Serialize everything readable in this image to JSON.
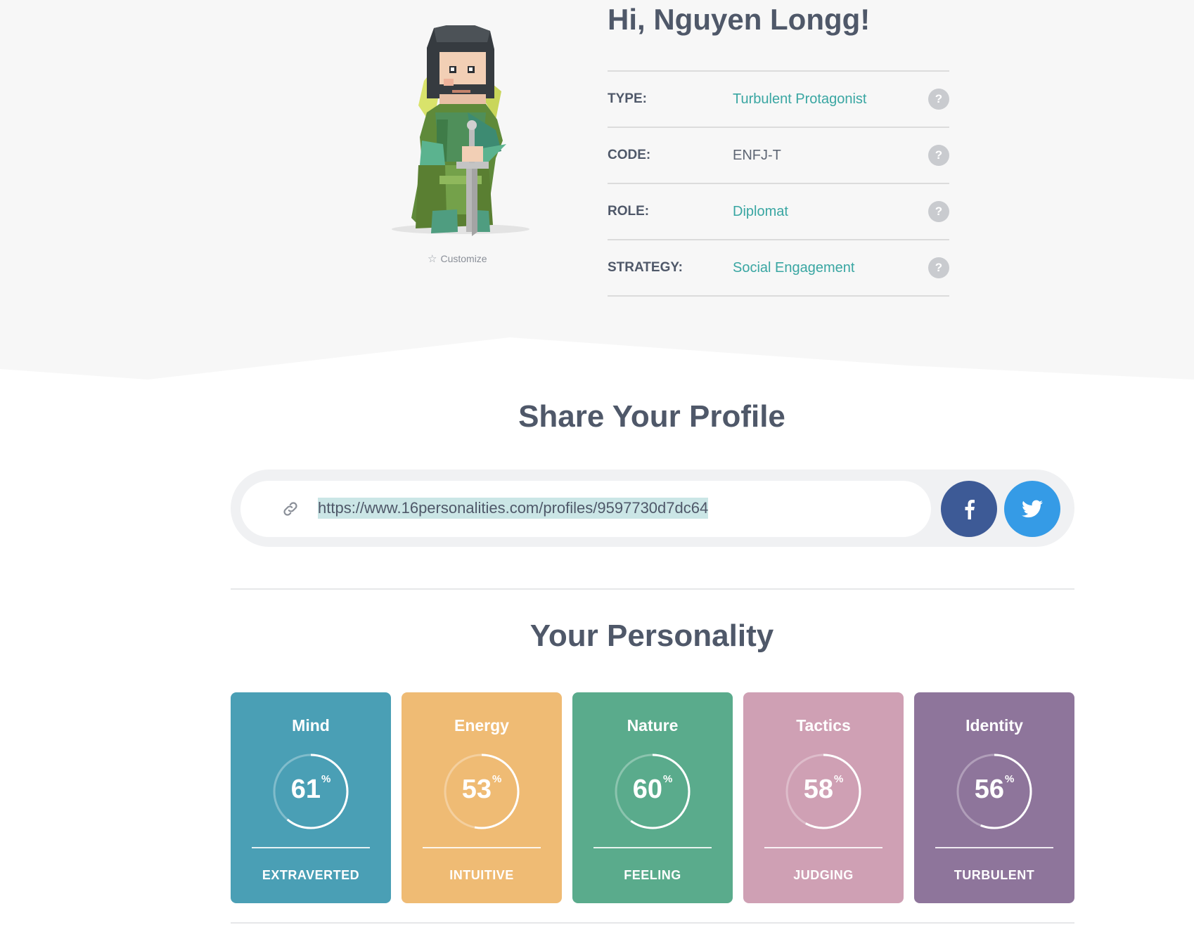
{
  "profile": {
    "greeting": "Hi, Nguyen Longg!",
    "customize_label": "Customize",
    "rows": [
      {
        "label": "TYPE:",
        "value": "Turbulent Protagonist",
        "help": "?"
      },
      {
        "label": "CODE:",
        "value": "ENFJ-T",
        "help": "?"
      },
      {
        "label": "ROLE:",
        "value": "Diplomat",
        "help": "?"
      },
      {
        "label": "STRATEGY:",
        "value": "Social Engagement",
        "help": "?"
      }
    ]
  },
  "share": {
    "title": "Share Your Profile",
    "url": "https://www.16personalities.com/profiles/9597730d7dc64",
    "facebook_icon": "facebook-icon",
    "twitter_icon": "twitter-icon"
  },
  "personality": {
    "title": "Your Personality",
    "percent_symbol": "%",
    "traits": [
      {
        "title": "Mind",
        "percent": 61,
        "trait": "EXTRAVERTED",
        "color": "#4a9fb5"
      },
      {
        "title": "Energy",
        "percent": 53,
        "trait": "INTUITIVE",
        "color": "#efbb74"
      },
      {
        "title": "Nature",
        "percent": 60,
        "trait": "FEELING",
        "color": "#5aab8c"
      },
      {
        "title": "Tactics",
        "percent": 58,
        "trait": "JUDGING",
        "color": "#cfa0b4"
      },
      {
        "title": "Identity",
        "percent": 56,
        "trait": "TURBULENT",
        "color": "#8e759b"
      }
    ]
  },
  "colors": {
    "hero_background": "#f7f7f7",
    "accent": "#39a6a2",
    "facebook": "#3d5a96",
    "twitter": "#359be6"
  }
}
